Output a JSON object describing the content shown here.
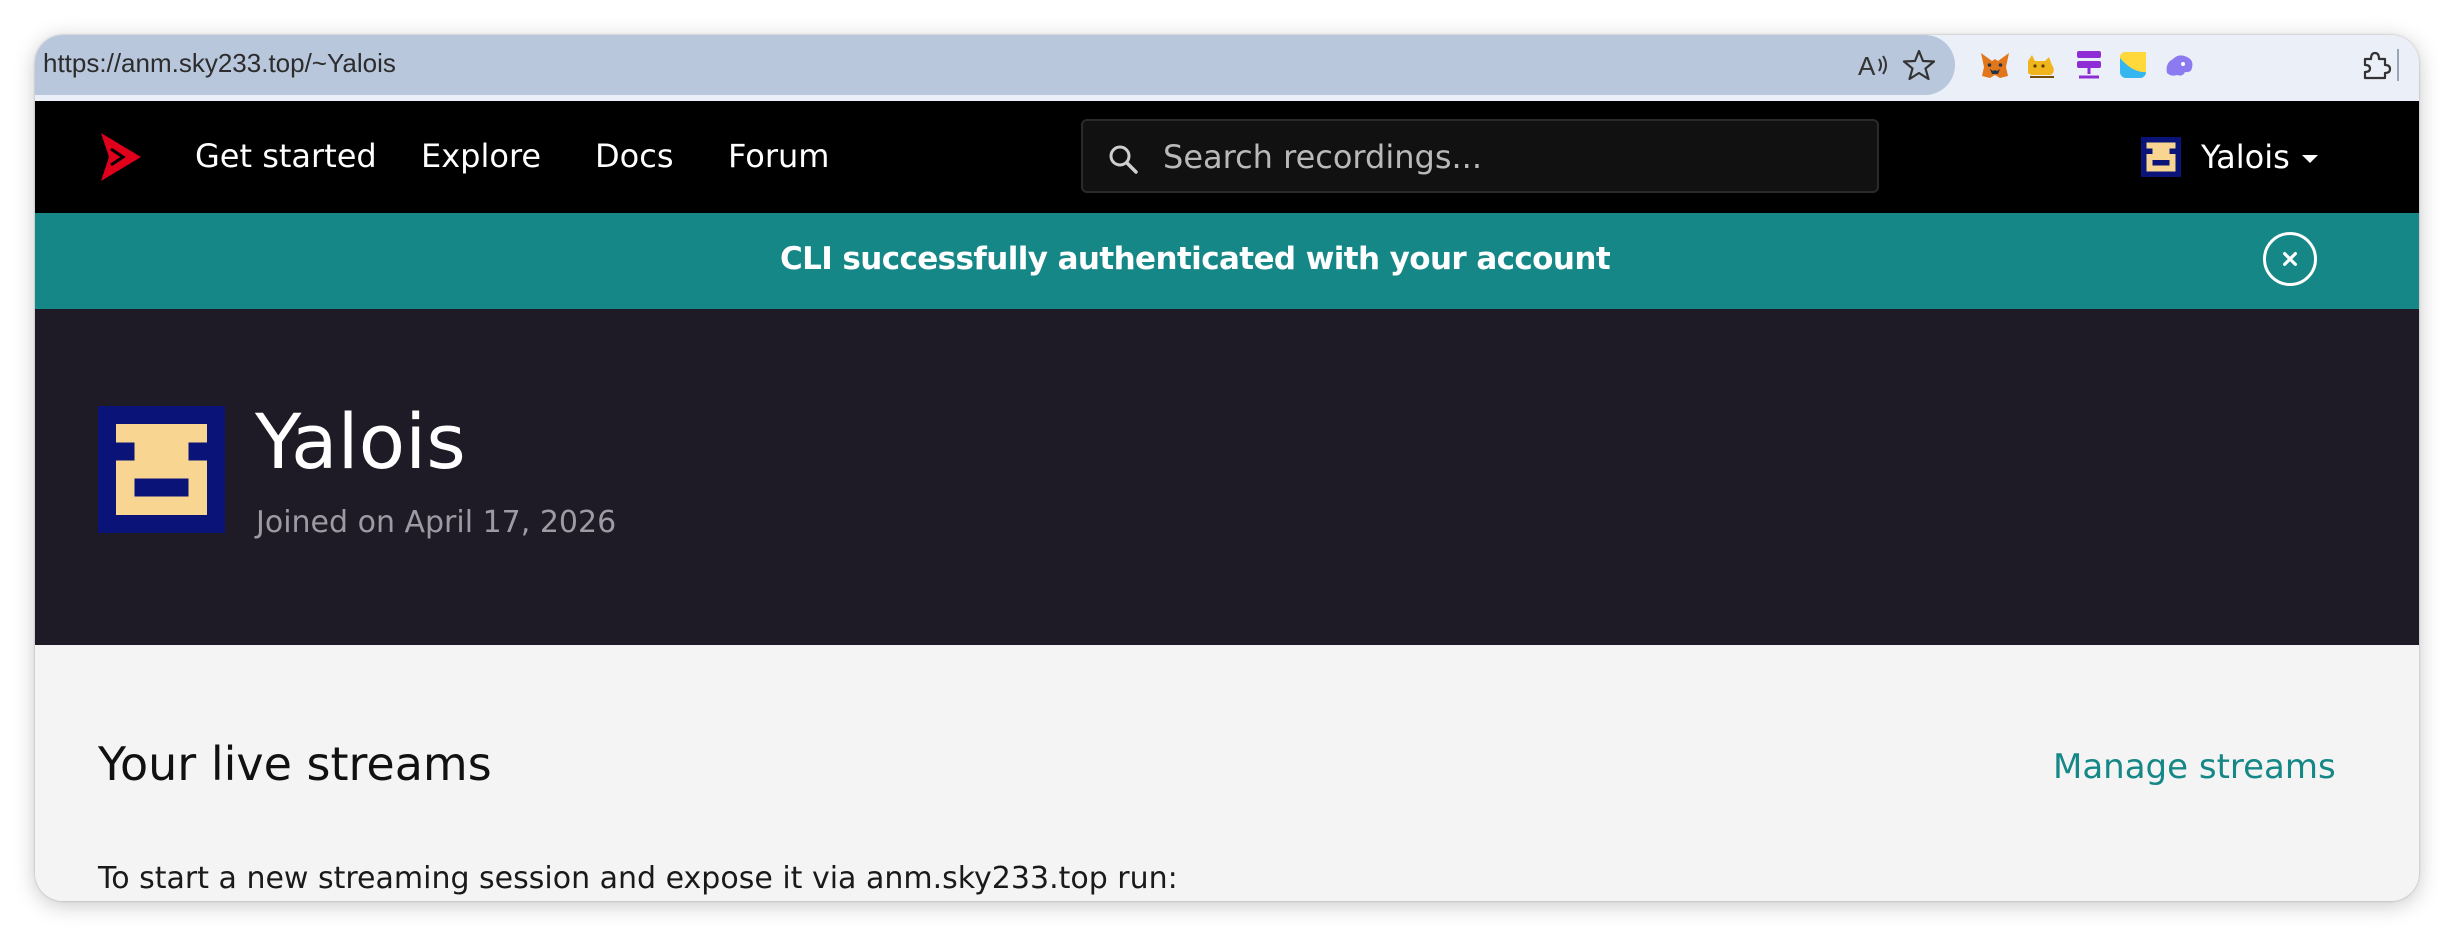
{
  "browser": {
    "url": "https://anm.sky233.top/~Yalois",
    "icons": [
      "read-aloud-icon",
      "favorite-star-icon",
      "metamask-fox-icon",
      "cat-extension-icon",
      "network-extension-icon",
      "sticky-note-icon",
      "cloud-extension-icon",
      "extensions-puzzle-icon"
    ]
  },
  "nav": {
    "links": [
      "Get started",
      "Explore",
      "Docs",
      "Forum"
    ],
    "search_placeholder": "Search recordings...",
    "user_name": "Yalois"
  },
  "flash": {
    "message": "CLI successfully authenticated with your account",
    "close_label": "×"
  },
  "profile": {
    "name": "Yalois",
    "joined": "Joined on April 17, 2026"
  },
  "streams": {
    "heading": "Your live streams",
    "manage_link": "Manage streams",
    "instructions": "To start a new streaming session and expose it via anm.sky233.top run:"
  },
  "colors": {
    "accent": "#168787",
    "nav_bg": "#000000",
    "profile_bg": "#1e1b26",
    "avatar_bg": "#0a1478",
    "avatar_fg": "#f8d590",
    "logo_red": "#e0001b"
  }
}
